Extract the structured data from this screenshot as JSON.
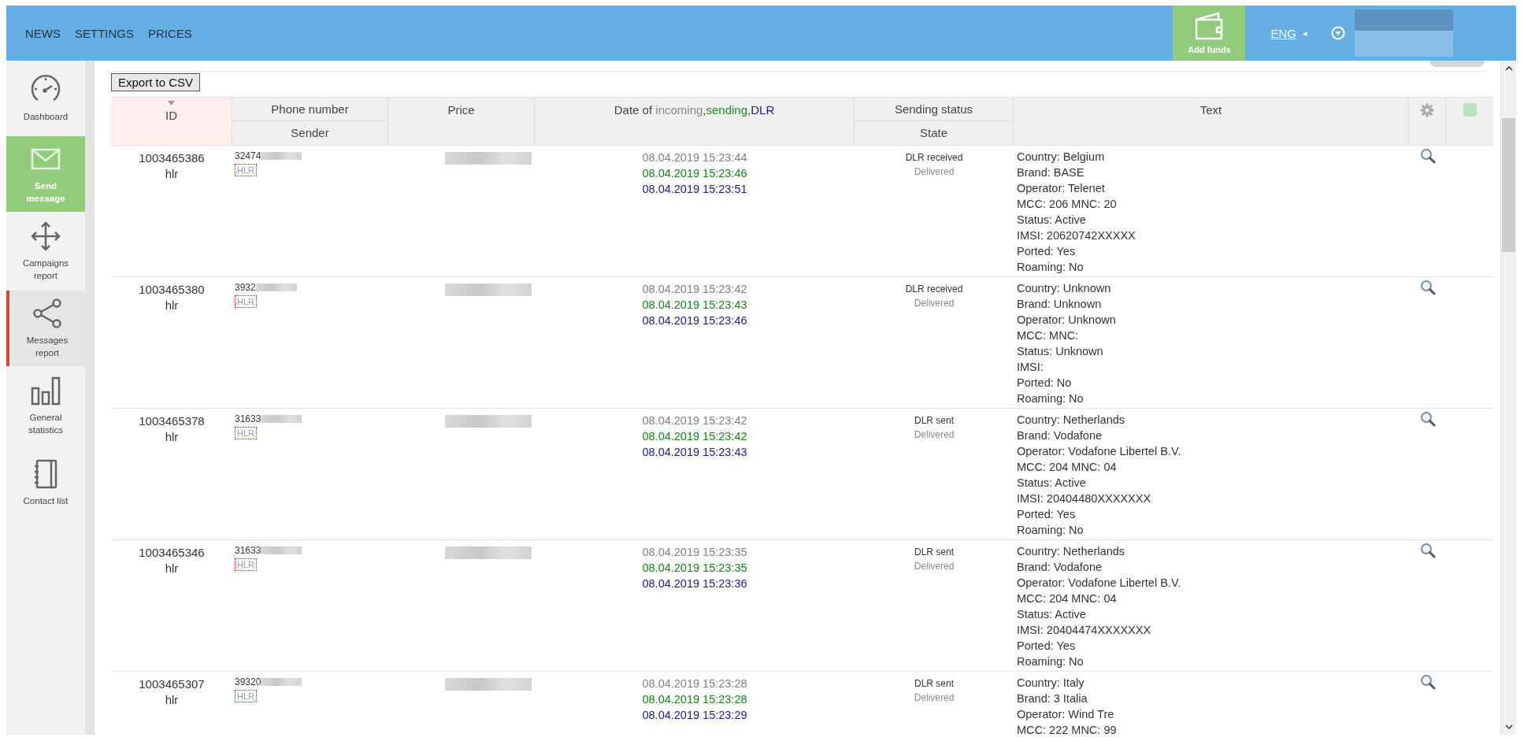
{
  "top_nav": {
    "links": [
      "NEWS",
      "SETTINGS",
      "PRICES"
    ],
    "add_funds": "Add funds",
    "language": "ENG",
    "language_arrow": "◂"
  },
  "sidebar": {
    "items": [
      {
        "label": "Dashboard",
        "kind": "normal",
        "selected": false
      },
      {
        "label": "Send message",
        "kind": "primary",
        "selected": false
      },
      {
        "label": "Campaigns report",
        "kind": "normal",
        "selected": false
      },
      {
        "label": "Messages report",
        "kind": "normal",
        "selected": true
      },
      {
        "label": "General statistics",
        "kind": "normal",
        "selected": false
      },
      {
        "label": "Contact list",
        "kind": "normal",
        "selected": false
      }
    ]
  },
  "export_button": "Export to CSV",
  "table": {
    "columns": {
      "id": "ID",
      "phone": "Phone number",
      "sender": "Sender",
      "price": "Price",
      "date_prefix": "Date of",
      "date_separator": ",",
      "date_parts": [
        {
          "text": "incoming",
          "color": "#888888"
        },
        {
          "text": "sending",
          "color": "#1a8a1a"
        },
        {
          "text": "DLR",
          "color": "#1a1a8c"
        }
      ],
      "status": "Sending status",
      "state": "State",
      "text": "Text"
    },
    "rows": [
      {
        "id": "1003465386",
        "type": "hlr",
        "phone": "32474",
        "sender": "HLR",
        "incoming": "08.04.2019 15:23:44",
        "sending": "08.04.2019 15:23:46",
        "dlr": "08.04.2019 15:23:51",
        "status": "DLR received",
        "state": "Delivered",
        "text": [
          "Country: Belgium",
          "Brand: BASE",
          "Operator: Telenet",
          "MCC: 206 MNC: 20",
          "Status: Active",
          "IMSI: 20620742XXXXX",
          "Ported: Yes",
          "Roaming: No"
        ]
      },
      {
        "id": "1003465380",
        "type": "hlr",
        "phone": "3932",
        "sender": "HLR",
        "incoming": "08.04.2019 15:23:42",
        "sending": "08.04.2019 15:23:43",
        "dlr": "08.04.2019 15:23:46",
        "status": "DLR received",
        "state": "Delivered",
        "text": [
          "Country: Unknown",
          "Brand: Unknown",
          "Operator: Unknown",
          "MCC: MNC:",
          "Status: Unknown",
          "IMSI:",
          "Ported: No",
          "Roaming: No"
        ]
      },
      {
        "id": "1003465378",
        "type": "hlr",
        "phone": "31633",
        "sender": "HLR",
        "incoming": "08.04.2019 15:23:42",
        "sending": "08.04.2019 15:23:42",
        "dlr": "08.04.2019 15:23:43",
        "status": "DLR sent",
        "state": "Delivered",
        "text": [
          "Country: Netherlands",
          "Brand: Vodafone",
          "Operator: Vodafone Libertel B.V.",
          "MCC: 204 MNC: 04",
          "Status: Active",
          "IMSI: 20404480XXXXXXX",
          "Ported: Yes",
          "Roaming: No"
        ]
      },
      {
        "id": "1003465346",
        "type": "hlr",
        "phone": "31633",
        "sender": "HLR",
        "incoming": "08.04.2019 15:23:35",
        "sending": "08.04.2019 15:23:35",
        "dlr": "08.04.2019 15:23:36",
        "status": "DLR sent",
        "state": "Delivered",
        "text": [
          "Country: Netherlands",
          "Brand: Vodafone",
          "Operator: Vodafone Libertel B.V.",
          "MCC: 204 MNC: 04",
          "Status: Active",
          "IMSI: 20404474XXXXXXX",
          "Ported: Yes",
          "Roaming: No"
        ]
      },
      {
        "id": "1003465307",
        "type": "hlr",
        "phone": "39320",
        "sender": "HLR",
        "incoming": "08.04.2019 15:23:28",
        "sending": "08.04.2019 15:23:28",
        "dlr": "08.04.2019 15:23:29",
        "status": "DLR sent",
        "state": "Delivered",
        "text": [
          "Country: Italy",
          "Brand: 3 Italia",
          "Operator: Wind Tre",
          "MCC: 222 MNC: 99"
        ]
      }
    ]
  }
}
